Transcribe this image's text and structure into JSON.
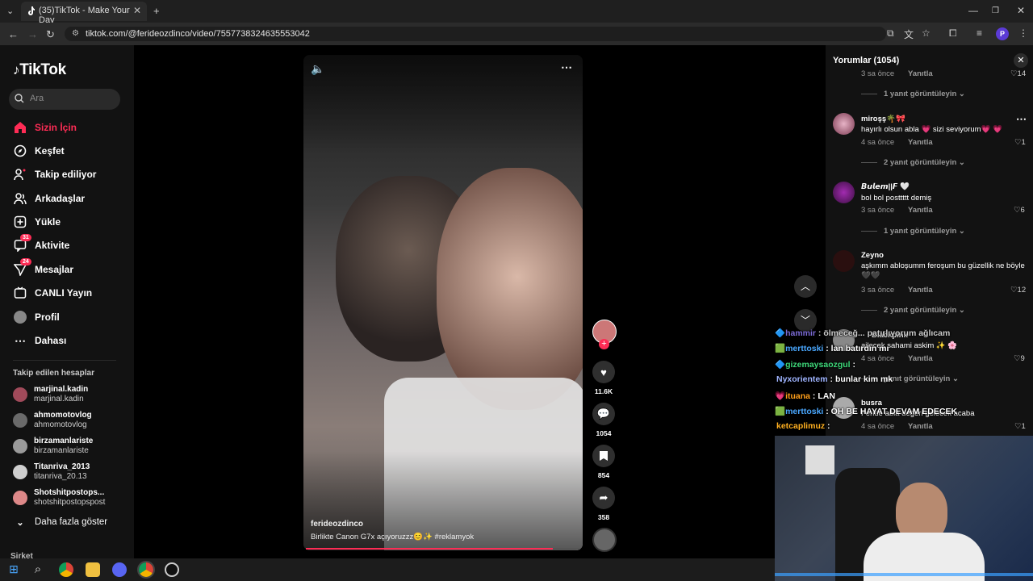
{
  "browser": {
    "tab_title": "(35)TikTok - Make Your Day",
    "tab_close": "✕",
    "new_tab": "+",
    "url": "tiktok.com/@ferideozdinco/video/7557738324635553042",
    "profile_initial": "P"
  },
  "sidebar": {
    "logo": "TikTok",
    "search_placeholder": "Ara",
    "items": [
      {
        "label": "Sizin İçin",
        "icon": "home-icon",
        "active": true
      },
      {
        "label": "Keşfet",
        "icon": "compass-icon"
      },
      {
        "label": "Takip ediliyor",
        "icon": "following-icon"
      },
      {
        "label": "Arkadaşlar",
        "icon": "friends-icon"
      },
      {
        "label": "Yükle",
        "icon": "upload-icon"
      },
      {
        "label": "Aktivite",
        "icon": "activity-icon",
        "badge": "31"
      },
      {
        "label": "Mesajlar",
        "icon": "messages-icon",
        "badge": "24"
      },
      {
        "label": "CANLI Yayın",
        "icon": "live-icon"
      },
      {
        "label": "Profil",
        "icon": "profile-icon"
      },
      {
        "label": "Dahası",
        "icon": "more-icon"
      }
    ],
    "following_title": "Takip edilen hesaplar",
    "following": [
      {
        "name": "marjinal.kadin",
        "handle": "marjinal.kadin"
      },
      {
        "name": "ahmomotovlog",
        "handle": "ahmomotovlog"
      },
      {
        "name": "birzamanlariste",
        "handle": "birzamanlariste"
      },
      {
        "name": "Titanriva_2013",
        "handle": "titanriva_20.13"
      },
      {
        "name": "Shotshitpostops...",
        "handle": "shotshitpostopspost"
      }
    ],
    "show_more": "Daha fazla göster",
    "company": "Şirket"
  },
  "video": {
    "author": "ferideozdinco",
    "caption": "Birlikte Canon G7x açıyoruzzz😊✨ #reklamyok",
    "progress": 0.9
  },
  "actions": {
    "likes": "11.6K",
    "comments": "1054",
    "saves": "854",
    "shares": "358"
  },
  "comments": {
    "title": "Yorumlar (1054)",
    "close": "✕",
    "reply_label": "Yanıtla",
    "top_meta": {
      "time": "3 sa önce",
      "likes": "14",
      "view": "1 yanıt görüntüleyin"
    },
    "list": [
      {
        "user": "miroşş🌴🎀",
        "text": "hayırlı olsun abla 💗 sizi seviyorum💗 💗",
        "time": "4 sa önce",
        "likes": "1",
        "view": "2 yanıt görüntüleyin"
      },
      {
        "user": "𝘽𝙪𝙡𝙚𝙢||𝙁 🤍",
        "text": "bol bol posttttt demiş",
        "time": "3 sa önce",
        "likes": "6",
        "view": "1 yanıt görüntüleyin"
      },
      {
        "user": "Zeyno",
        "text": "aşkımm abloşumm feroşum bu güzellik ne böyle 🖤🖤",
        "time": "3 sa önce",
        "likes": "12",
        "view": "2 yanıt görüntüleyin"
      },
      {
        "user": "Blackpink",
        "text": "ailecek sahami askim ✨ 🌸",
        "time": "4 sa önce",
        "likes": "9",
        "view": "yanıt görüntüleyin"
      },
      {
        "user": "busra",
        "text": "Feride abla değeri gelecek acaba",
        "time": "4 sa önce",
        "likes": "1",
        "view": ""
      }
    ]
  },
  "chat": [
    {
      "user": "hammir",
      "msg": " : ölmeceğ... patırlıyorum ağlıcam",
      "color": "#7c6bd6"
    },
    {
      "user": "merttoski",
      "msg": " : lan batırdın mı",
      "color": "#4aa8ff"
    },
    {
      "user": "gizemaysaozgul",
      "msg": " : ",
      "color": "#3ed87a"
    },
    {
      "user": "Nyxorientem",
      "msg": " : bunlar kim mk",
      "color": "#9fb4ff"
    },
    {
      "user": "ituana",
      "msg": " : LAN",
      "color": "#ff9f1a"
    },
    {
      "user": "merttoski",
      "msg": " : OH BE HAYAT DEVAM EDECEK",
      "color": "#4aa8ff"
    },
    {
      "user": "ketcaplimuz",
      "msg": " : ",
      "color": "#ffb020"
    }
  ]
}
